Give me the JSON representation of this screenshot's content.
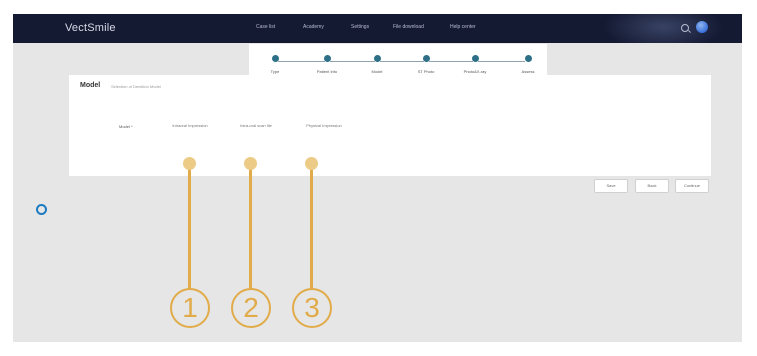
{
  "header": {
    "brand": "VectSmile",
    "nav": [
      "Case list",
      "Academy",
      "Settings",
      "File download",
      "Help center"
    ]
  },
  "stepper": {
    "steps": [
      "Type",
      "Patient Info",
      "Model",
      "ST Photo",
      "Photo&X-ray",
      "Assess"
    ]
  },
  "form": {
    "title": "Model",
    "subtitle": "Selection of Dentition Model",
    "field_label": "Model *",
    "options": [
      "Intraoral Impression",
      "Intra-oral scan file",
      "Physical Impression"
    ]
  },
  "actions": {
    "buttons": [
      "Save",
      "Back",
      "Continue"
    ]
  },
  "callouts": [
    "1",
    "2",
    "3"
  ],
  "colors": {
    "header_bg": "#151a33",
    "step_active": "#2c6f86",
    "callout": "#e1ab49",
    "callout_dot": "#eccb86",
    "page_bg": "#e6e6e6"
  }
}
